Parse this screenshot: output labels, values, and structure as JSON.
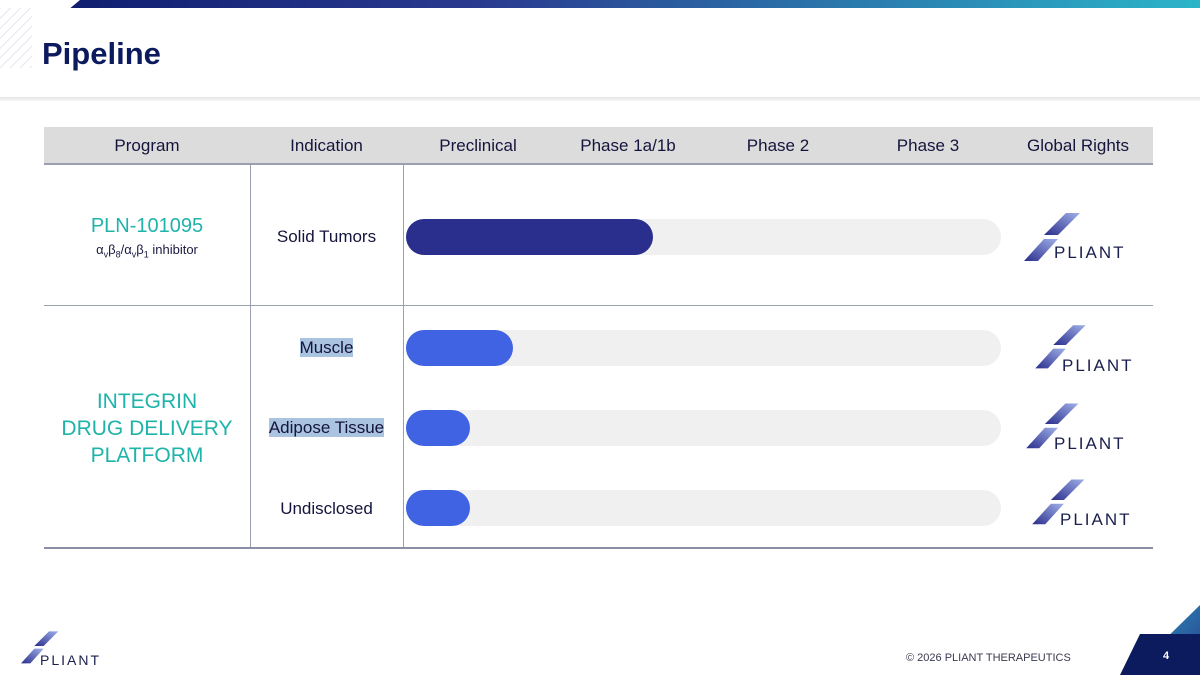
{
  "slide": {
    "title": "Pipeline",
    "copyright": "© 2026 PLIANT THERAPEUTICS",
    "page_number": "4"
  },
  "brand": {
    "logo_text": "PLIANT",
    "colors": {
      "title": "#0c1a5e",
      "program_text": "#1fb3aa",
      "bar_dark": "#2a2e8c",
      "bar_light": "#3f63e3",
      "track": "#f0f0f0",
      "highlight": "#a9c3e0"
    }
  },
  "table": {
    "headers": [
      "Program",
      "Indication",
      "Preclinical",
      "Phase 1a/1b",
      "Phase 2",
      "Phase 3",
      "Global Rights"
    ],
    "programs": [
      {
        "name": "PLN-101095",
        "subtitle_parts": [
          "α",
          "v",
          "β",
          "8",
          "/α",
          "v",
          "β",
          "1",
          " inhibitor"
        ]
      },
      {
        "name_lines": [
          "INTEGRIN",
          "DRUG DELIVERY",
          "PLATFORM"
        ]
      }
    ],
    "rows": [
      {
        "indication": "Solid Tumors",
        "progress": 0.415,
        "bar_color": "#2a2e8c",
        "highlighted": false
      },
      {
        "indication": "Muscle",
        "progress": 0.18,
        "bar_color": "#3f63e3",
        "highlighted": true
      },
      {
        "indication": "Adipose Tissue",
        "progress": 0.108,
        "bar_color": "#3f63e3",
        "highlighted": true
      },
      {
        "indication": "Undisclosed",
        "progress": 0.108,
        "bar_color": "#3f63e3",
        "highlighted": false
      }
    ]
  }
}
